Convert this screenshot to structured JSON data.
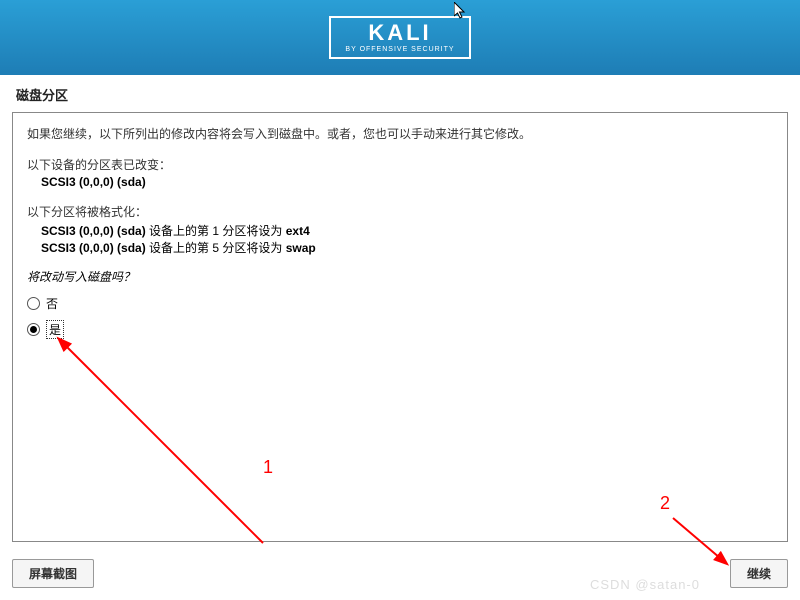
{
  "header": {
    "logo_text": "KALI",
    "logo_sub": "BY OFFENSIVE SECURITY"
  },
  "title": "磁盘分区",
  "main": {
    "intro": "如果您继续，以下所列出的修改内容将会写入到磁盘中。或者，您也可以手动来进行其它修改。",
    "devices_changed_label": "以下设备的分区表已改变：",
    "device_line": "SCSI3 (0,0,0) (sda)",
    "format_label": "以下分区将被格式化：",
    "partition_lines": [
      {
        "prefix": "SCSI3 (0,0,0) (sda)",
        "mid": " 设备上的第 1 分区将设为 ",
        "fs": "ext4"
      },
      {
        "prefix": "SCSI3 (0,0,0) (sda)",
        "mid": " 设备上的第 5 分区将设为 ",
        "fs": "swap"
      }
    ],
    "confirm_question": "将改动写入磁盘吗？",
    "radio_no": "否",
    "radio_yes": "是"
  },
  "buttons": {
    "screenshot": "屏幕截图",
    "continue": "继续"
  },
  "annotations": {
    "num1": "1",
    "num2": "2"
  },
  "watermark": "CSDN @satan-0"
}
